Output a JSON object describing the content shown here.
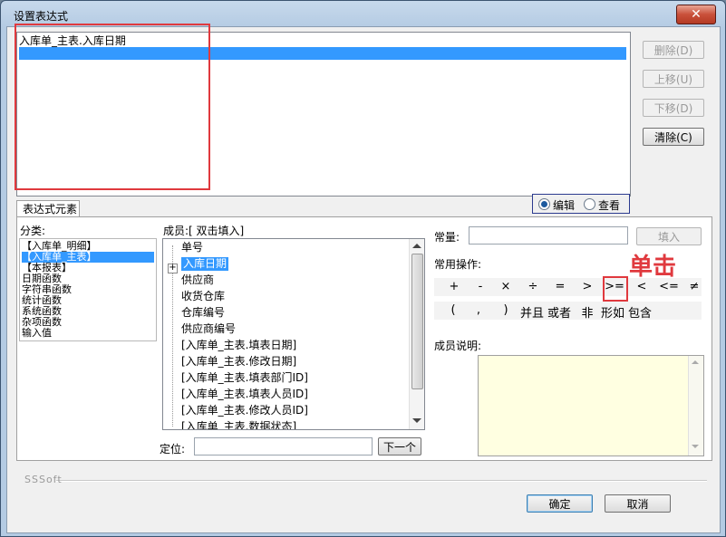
{
  "window": {
    "title": "设置表达式",
    "close_label": "✕"
  },
  "expression": {
    "rows": [
      "入库单_主表.入库日期",
      ""
    ],
    "selected_index": 1
  },
  "side_buttons": {
    "delete": "删除(D)",
    "move_up": "上移(U)",
    "move_down": "下移(D)",
    "clear": "清除(C)"
  },
  "mode": {
    "edit": "编辑",
    "view": "查看",
    "selected": "edit"
  },
  "tab": {
    "label": "表达式元素"
  },
  "category": {
    "label": "分类:",
    "items": [
      "【入库单_明细】",
      "【入库单_主表】",
      "【本报表】",
      "日期函数",
      "字符串函数",
      "统计函数",
      "系统函数",
      "杂项函数",
      "输入值"
    ],
    "selected_index": 1
  },
  "members": {
    "label": "成员:[ 双击填入]",
    "items": [
      "单号",
      "入库日期",
      "供应商",
      "收货仓库",
      "仓库编号",
      "供应商编号",
      "[入库单_主表.填表日期]",
      "[入库单_主表.修改日期]",
      "[入库单_主表.填表部门ID]",
      "[入库单_主表.填表人员ID]",
      "[入库单_主表.修改人员ID]",
      "[入库单_主表.数据状态]"
    ],
    "selected_index": 1,
    "expand_symbol": "+"
  },
  "locate": {
    "label": "定位:",
    "value": "",
    "next_button": "下一个"
  },
  "constant": {
    "label": "常量:",
    "value": "",
    "fill_button": "填入"
  },
  "operations": {
    "label": "常用操作:",
    "row1": [
      "+",
      "-",
      "×",
      "÷",
      "=",
      ">",
      ">=",
      "<",
      "<=",
      "≠"
    ],
    "row2": [
      "(",
      ",",
      ")",
      "并且",
      "或者",
      "非",
      "形如",
      "包含"
    ],
    "highlighted": ">="
  },
  "annotation": {
    "text": "单击",
    "color": "#e0393e"
  },
  "member_desc": {
    "label": "成员说明:"
  },
  "footer": {
    "brand": "SSSoft",
    "ok": "确定",
    "cancel": "取消"
  }
}
